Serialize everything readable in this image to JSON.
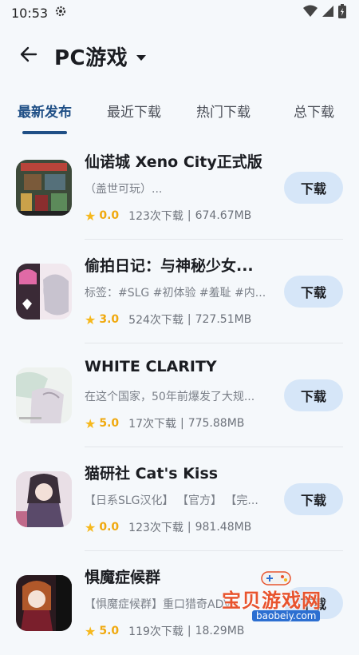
{
  "status_bar": {
    "time": "10:53",
    "icons": [
      "settings-gear-icon",
      "wifi-icon",
      "cellular-signal-icon",
      "battery-icon"
    ]
  },
  "app_bar": {
    "back_icon": "arrow-left-icon",
    "title": "PC游戏",
    "dropdown_icon": "caret-down-icon"
  },
  "tabs": [
    {
      "label": "最新发布",
      "active": true
    },
    {
      "label": "最近下载",
      "active": false
    },
    {
      "label": "热门下载",
      "active": false
    },
    {
      "label": "总下载",
      "active": false
    }
  ],
  "colors": {
    "accent": "#1f4f86",
    "button_bg": "#d6e6f8",
    "star": "#f6b81c",
    "background": "#f5f8fb"
  },
  "games": [
    {
      "name": "仙诺城 Xeno City正式版",
      "description": "（盖世可玩）...",
      "rating": "0.0",
      "downloads": "123次下载",
      "size": "674.67MB",
      "button": "下载"
    },
    {
      "name": "偷拍日记：与神秘少女...",
      "description": "标签：#SLG #初体验 #羞耻 #内...",
      "rating": "3.0",
      "downloads": "524次下载",
      "size": "727.51MB",
      "button": "下载"
    },
    {
      "name": "WHITE CLARITY",
      "description": "在这个国家，50年前爆发了大规...",
      "rating": "5.0",
      "downloads": "17次下载",
      "size": "775.88MB",
      "button": "下载"
    },
    {
      "name": "猫研社 Cat's Kiss",
      "description": "【日系SLG汉化】 【官方】 【完...",
      "rating": "0.0",
      "downloads": "123次下载",
      "size": "981.48MB",
      "button": "下载"
    },
    {
      "name": "惧魔症候群",
      "description": "【惧魔症候群】重口猎奇ADV...",
      "rating": "5.0",
      "downloads": "119次下载",
      "size": "18.29MB",
      "button": "下载"
    }
  ],
  "meta_separator": "|",
  "watermark": {
    "text": "宝贝游戏网",
    "url": "baobeiy.com"
  }
}
